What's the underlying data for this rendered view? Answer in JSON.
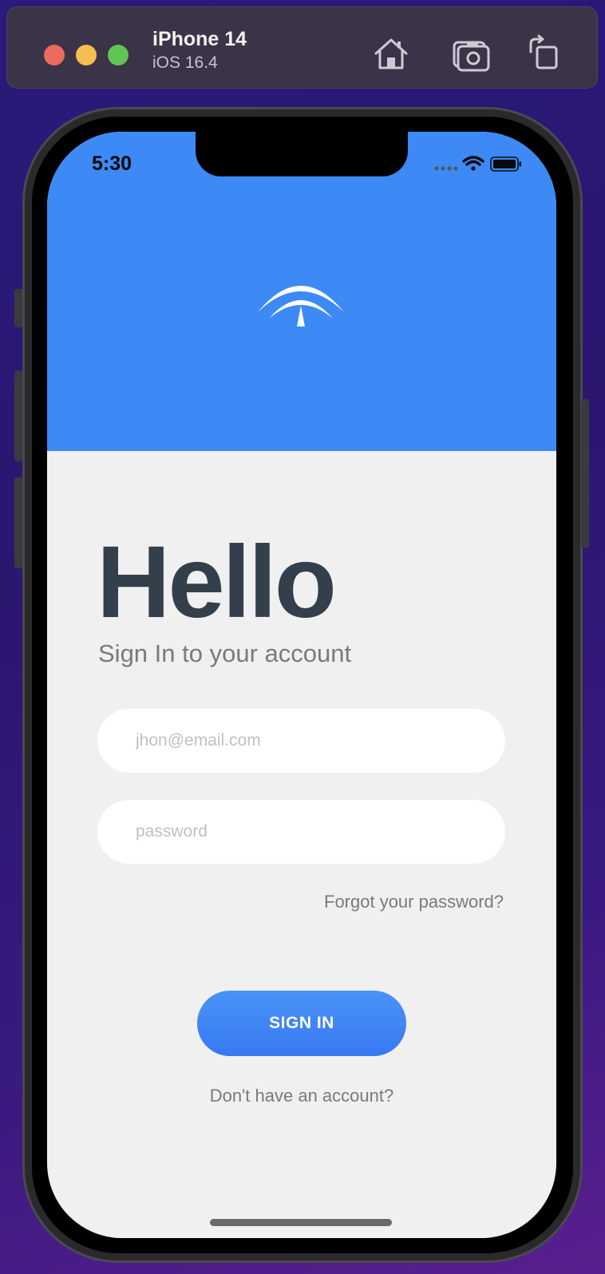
{
  "simulator": {
    "device_name": "iPhone 14",
    "os_version": "iOS 16.4",
    "toolbar_icons": [
      "home-icon",
      "screenshot-icon",
      "rotate-icon"
    ]
  },
  "status_bar": {
    "time": "5:30",
    "icons": [
      "signal-icon",
      "wifi-icon",
      "battery-icon"
    ]
  },
  "app": {
    "brand_color": "#3d89f5",
    "title": "Hello",
    "subtitle": "Sign In to your account",
    "email_placeholder": "jhon@email.com",
    "password_placeholder": "password",
    "forgot_link": "Forgot your password?",
    "signin_label": "SIGN IN",
    "signup_link": "Don't have an account?"
  }
}
